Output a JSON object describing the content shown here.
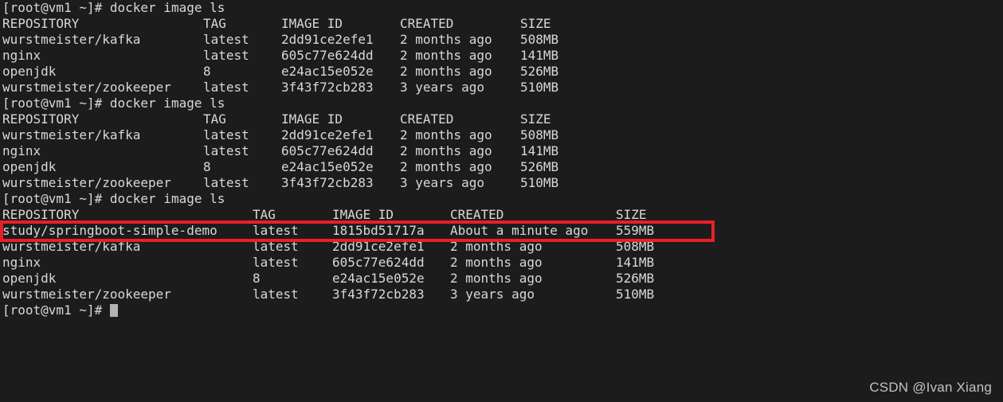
{
  "terminal": {
    "background_color": "#1c1c1c",
    "text_color": "#d8d8d8",
    "prompt": "[root@vm1 ~]#",
    "command": "docker image ls",
    "cursor": "block-cursor"
  },
  "highlight": {
    "color": "#ea1f26",
    "target_row": "study/springboot-simple-demo"
  },
  "columns": {
    "repository": "REPOSITORY",
    "tag": "TAG",
    "image_id": "IMAGE ID",
    "created": "CREATED",
    "size": "SIZE"
  },
  "blocks": [
    {
      "id": "block-1",
      "prompt": "[root@vm1 ~]#",
      "command": "docker image ls",
      "rows": [
        {
          "repository": "wurstmeister/kafka",
          "tag": "latest",
          "image_id": "2dd91ce2efe1",
          "created": "2 months ago",
          "size": "508MB"
        },
        {
          "repository": "nginx",
          "tag": "latest",
          "image_id": "605c77e624dd",
          "created": "2 months ago",
          "size": "141MB"
        },
        {
          "repository": "openjdk",
          "tag": "8",
          "image_id": "e24ac15e052e",
          "created": "2 months ago",
          "size": "526MB"
        },
        {
          "repository": "wurstmeister/zookeeper",
          "tag": "latest",
          "image_id": "3f43f72cb283",
          "created": "3 years ago",
          "size": "510MB"
        }
      ]
    },
    {
      "id": "block-2",
      "prompt": "[root@vm1 ~]#",
      "command": "docker image ls",
      "rows": [
        {
          "repository": "wurstmeister/kafka",
          "tag": "latest",
          "image_id": "2dd91ce2efe1",
          "created": "2 months ago",
          "size": "508MB"
        },
        {
          "repository": "nginx",
          "tag": "latest",
          "image_id": "605c77e624dd",
          "created": "2 months ago",
          "size": "141MB"
        },
        {
          "repository": "openjdk",
          "tag": "8",
          "image_id": "e24ac15e052e",
          "created": "2 months ago",
          "size": "526MB"
        },
        {
          "repository": "wurstmeister/zookeeper",
          "tag": "latest",
          "image_id": "3f43f72cb283",
          "created": "3 years ago",
          "size": "510MB"
        }
      ]
    },
    {
      "id": "block-3",
      "prompt": "[root@vm1 ~]#",
      "command": "docker image ls",
      "rows": [
        {
          "repository": "study/springboot-simple-demo",
          "tag": "latest",
          "image_id": "1815bd51717a",
          "created": "About a minute ago",
          "size": "559MB"
        },
        {
          "repository": "wurstmeister/kafka",
          "tag": "latest",
          "image_id": "2dd91ce2efe1",
          "created": "2 months ago",
          "size": "508MB"
        },
        {
          "repository": "nginx",
          "tag": "latest",
          "image_id": "605c77e624dd",
          "created": "2 months ago",
          "size": "141MB"
        },
        {
          "repository": "openjdk",
          "tag": "8",
          "image_id": "e24ac15e052e",
          "created": "2 months ago",
          "size": "526MB"
        },
        {
          "repository": "wurstmeister/zookeeper",
          "tag": "latest",
          "image_id": "3f43f72cb283",
          "created": "3 years ago",
          "size": "510MB"
        }
      ]
    }
  ],
  "final_prompt": "[root@vm1 ~]#",
  "watermark": "CSDN @Ivan Xiang"
}
